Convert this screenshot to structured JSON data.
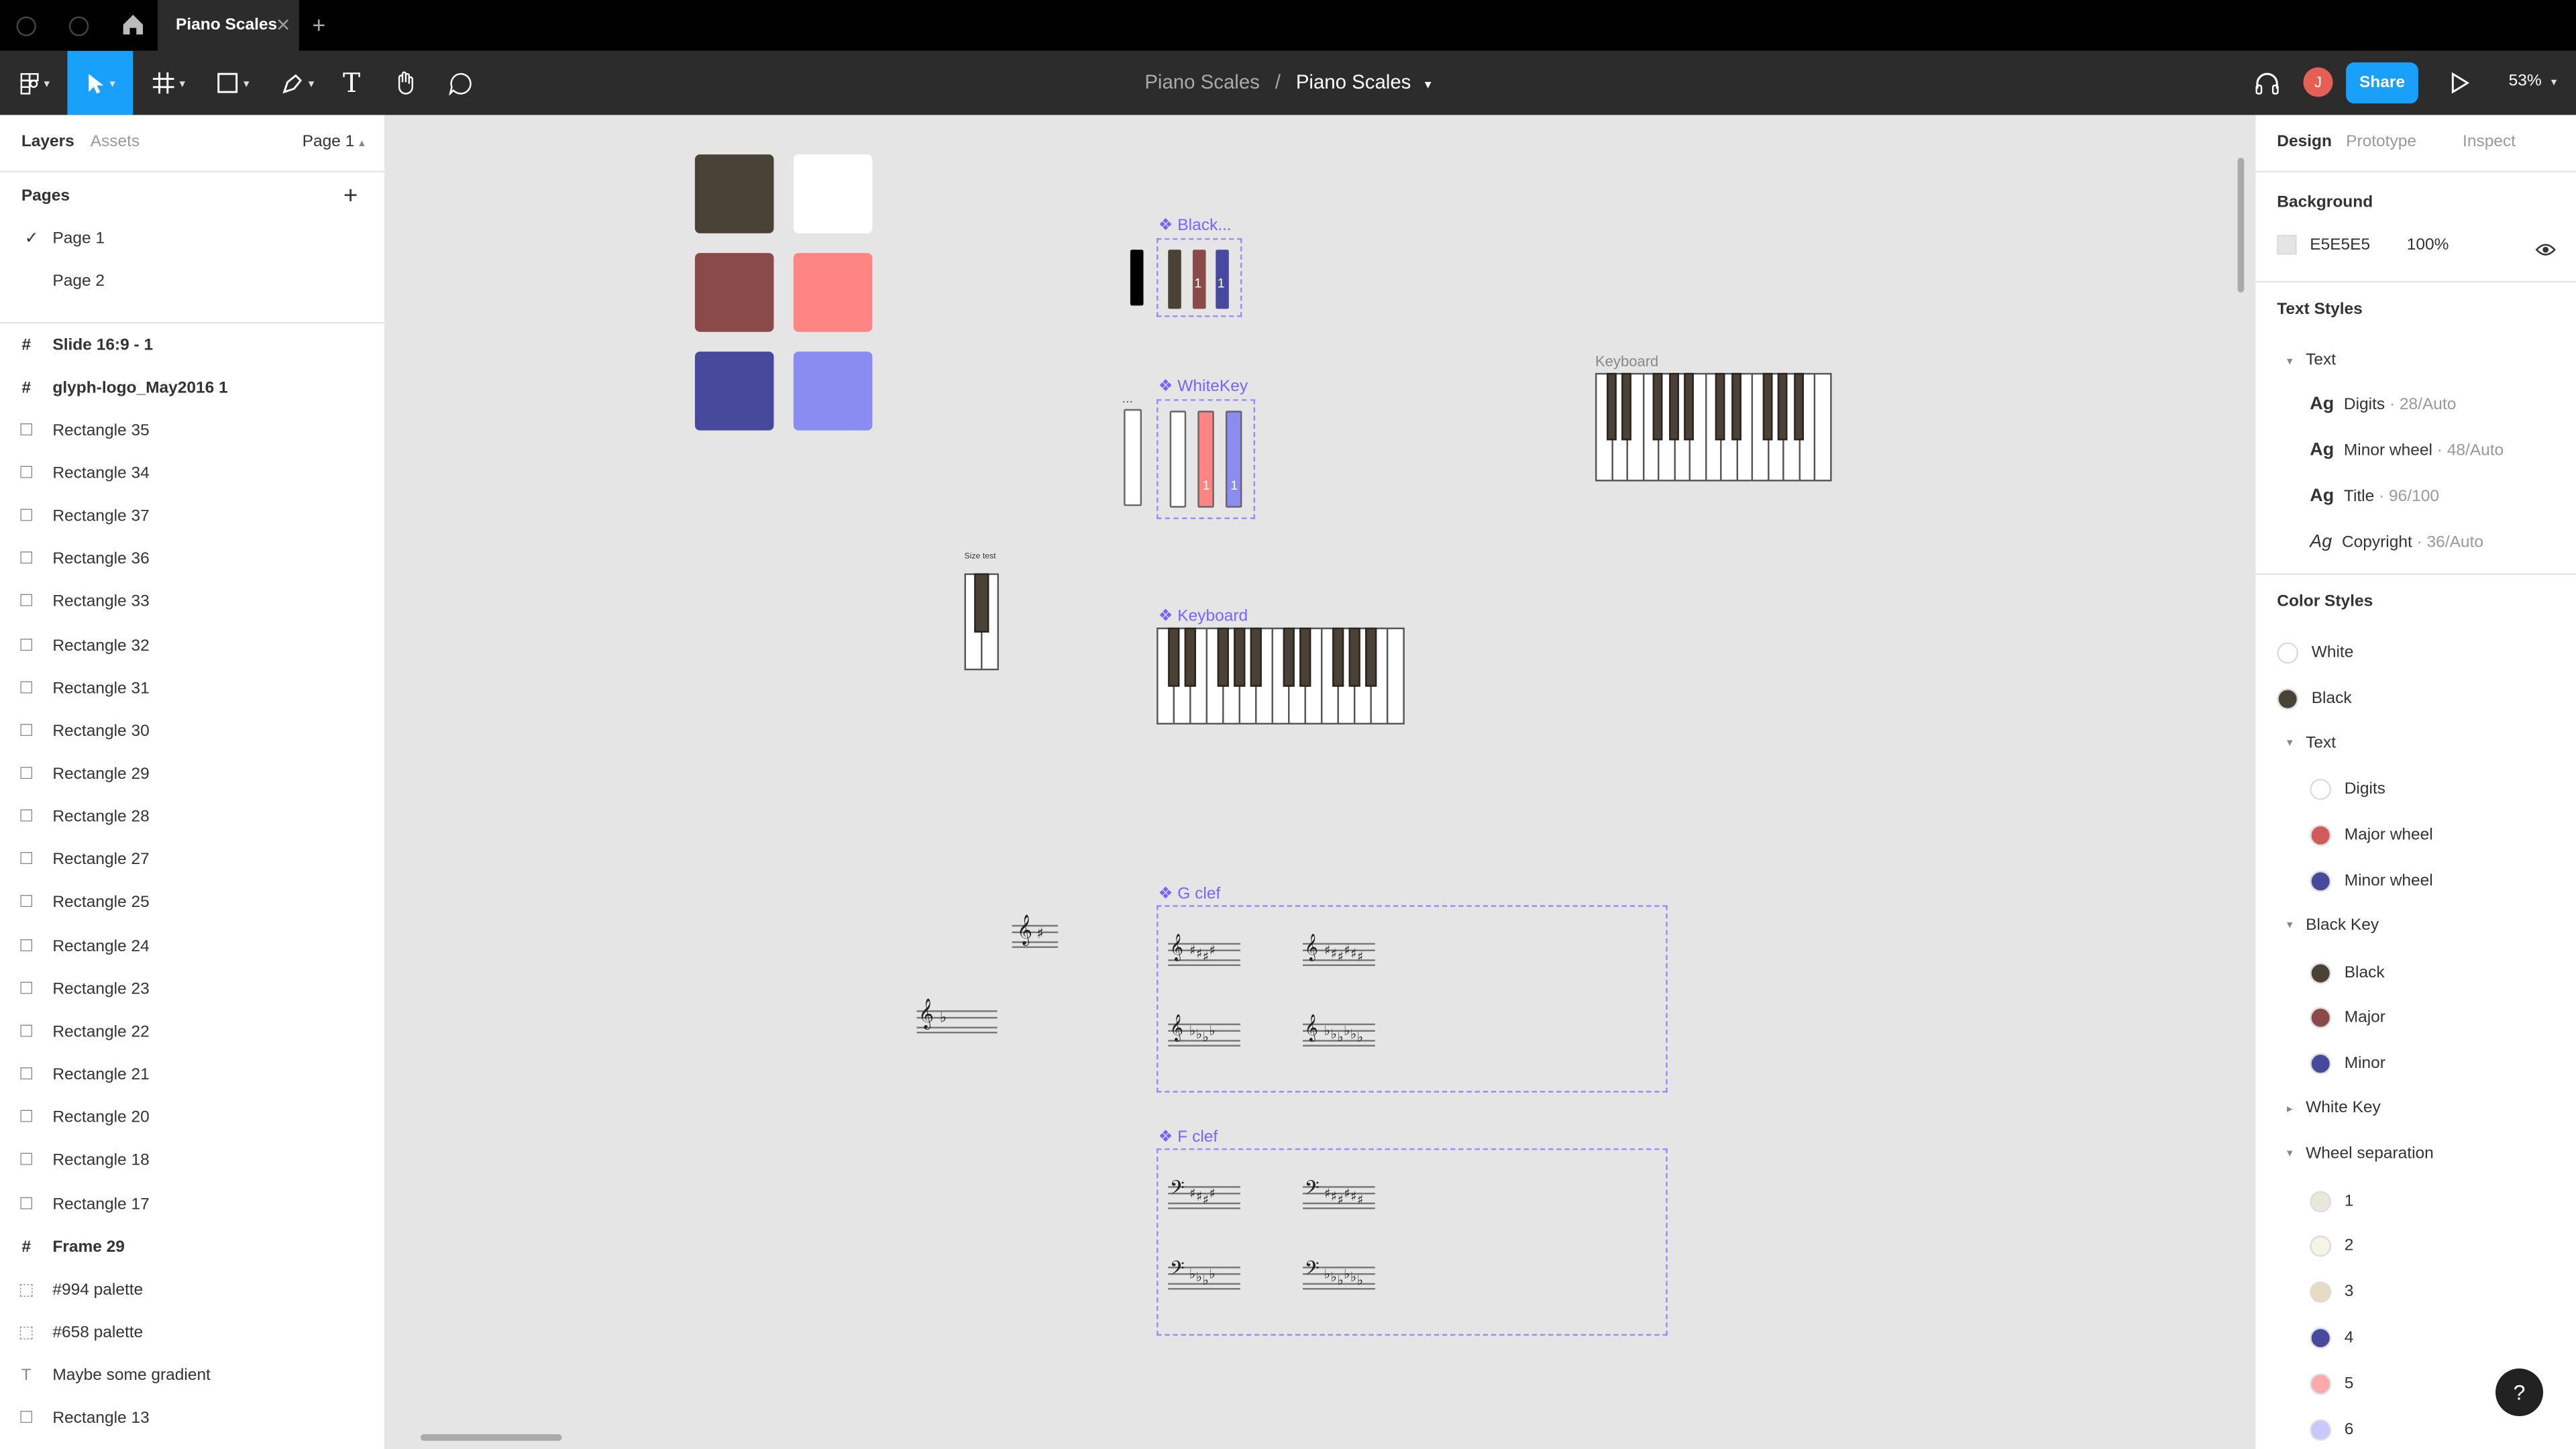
{
  "titlebar": {
    "tab_label": "Piano Scales",
    "close_glyph": "✕",
    "new_tab_glyph": "+"
  },
  "toolbar": {
    "project": "Piano Scales",
    "separator": "/",
    "file": "Piano Scales",
    "share_label": "Share",
    "avatar_initial": "J",
    "zoom": "53%"
  },
  "left_panel": {
    "tabs": [
      "Layers",
      "Assets"
    ],
    "page_selector": "Page 1",
    "pages_title": "Pages",
    "pages": [
      "Page 1",
      "Page 2"
    ],
    "layers": [
      {
        "label": "Slide 16:9 - 1",
        "icon": "frame-icon",
        "bold": true
      },
      {
        "label": "glyph-logo_May2016 1",
        "icon": "frame-icon",
        "bold": true
      },
      {
        "label": "Rectangle 35",
        "icon": "rectangle-icon"
      },
      {
        "label": "Rectangle 34",
        "icon": "rectangle-icon"
      },
      {
        "label": "Rectangle 37",
        "icon": "rectangle-icon"
      },
      {
        "label": "Rectangle 36",
        "icon": "rectangle-icon"
      },
      {
        "label": "Rectangle 33",
        "icon": "rectangle-icon"
      },
      {
        "label": "Rectangle 32",
        "icon": "rectangle-icon"
      },
      {
        "label": "Rectangle 31",
        "icon": "rectangle-icon"
      },
      {
        "label": "Rectangle 30",
        "icon": "rectangle-icon"
      },
      {
        "label": "Rectangle 29",
        "icon": "rectangle-icon"
      },
      {
        "label": "Rectangle 28",
        "icon": "rectangle-icon"
      },
      {
        "label": "Rectangle 27",
        "icon": "rectangle-icon"
      },
      {
        "label": "Rectangle 25",
        "icon": "rectangle-icon"
      },
      {
        "label": "Rectangle 24",
        "icon": "rectangle-icon"
      },
      {
        "label": "Rectangle 23",
        "icon": "rectangle-icon"
      },
      {
        "label": "Rectangle 22",
        "icon": "rectangle-icon"
      },
      {
        "label": "Rectangle 21",
        "icon": "rectangle-icon"
      },
      {
        "label": "Rectangle 20",
        "icon": "rectangle-icon"
      },
      {
        "label": "Rectangle 18",
        "icon": "rectangle-icon"
      },
      {
        "label": "Rectangle 17",
        "icon": "rectangle-icon"
      },
      {
        "label": "Frame 29",
        "icon": "frame-icon",
        "bold": true
      },
      {
        "label": "#994 palette",
        "icon": "group-icon"
      },
      {
        "label": "#658 palette",
        "icon": "group-icon"
      },
      {
        "label": "Maybe some gradient",
        "icon": "text-icon"
      },
      {
        "label": "Rectangle 13",
        "icon": "rectangle-icon"
      }
    ]
  },
  "right_panel": {
    "tabs": [
      "Design",
      "Prototype",
      "Inspect"
    ],
    "background_title": "Background",
    "background_hex": "E5E5E5",
    "background_opacity": "100%",
    "text_styles_title": "Text Styles",
    "text_group": "Text",
    "text_styles": [
      {
        "name": "Digits",
        "spec": " · 28/Auto",
        "sample": "Ag"
      },
      {
        "name": "Minor wheel",
        "spec": " · 48/Auto",
        "sample": "Ag"
      },
      {
        "name": "Title",
        "spec": " · 96/100",
        "sample": "Ag"
      },
      {
        "name": "Copyright",
        "spec": " · 36/Auto",
        "sample": "Ag"
      }
    ],
    "color_styles_title": "Color Styles",
    "color_styles": [
      {
        "name": "White",
        "color": "#ffffff",
        "indent": 0
      },
      {
        "name": "Black",
        "color": "#4a4237",
        "indent": 0
      },
      {
        "name": "Text",
        "group": true,
        "indent": 0
      },
      {
        "name": "Digits",
        "color": "#ffffff",
        "indent": 1
      },
      {
        "name": "Major wheel",
        "color": "#d15a5a",
        "indent": 1
      },
      {
        "name": "Minor wheel",
        "color": "#474a9c",
        "indent": 1
      },
      {
        "name": "Black Key",
        "group": true,
        "indent": 0
      },
      {
        "name": "Black",
        "color": "#4a4237",
        "indent": 1
      },
      {
        "name": "Major",
        "color": "#8b4a4a",
        "indent": 1
      },
      {
        "name": "Minor",
        "color": "#474a9c",
        "indent": 1
      },
      {
        "name": "White Key",
        "group": true,
        "collapsed": true,
        "indent": 0
      },
      {
        "name": "Wheel separation",
        "group": true,
        "indent": 0
      },
      {
        "name": "1",
        "color": "#e9e6dc",
        "indent": 1
      },
      {
        "name": "2",
        "color": "#f6f4e4",
        "indent": 1
      },
      {
        "name": "3",
        "color": "#e6dcc4",
        "indent": 1
      },
      {
        "name": "4",
        "color": "#474a9c",
        "indent": 1
      },
      {
        "name": "5",
        "color": "#ffaaaa",
        "indent": 1
      },
      {
        "name": "6",
        "color": "#c6c8ff",
        "indent": 1
      }
    ]
  },
  "canvas": {
    "palette_colors": [
      "#4a4237",
      "#ffffff",
      "#8b4a4a",
      "#ff8585",
      "#474a9c",
      "#8b8cf2"
    ],
    "labels": {
      "black_key": "Black...",
      "white_key": "WhiteKey",
      "keyboard_component": "Keyboard",
      "keyboard_frame": "Keyboard",
      "size_test": "Size test",
      "g_clef": "G clef",
      "f_clef": "F clef",
      "ellipsis": "..."
    },
    "key_digits": "1",
    "clef_symbols": {
      "g": "𝄞",
      "f": "𝄢",
      "sharp": "♯",
      "flat": "♭"
    }
  },
  "help_label": "?"
}
